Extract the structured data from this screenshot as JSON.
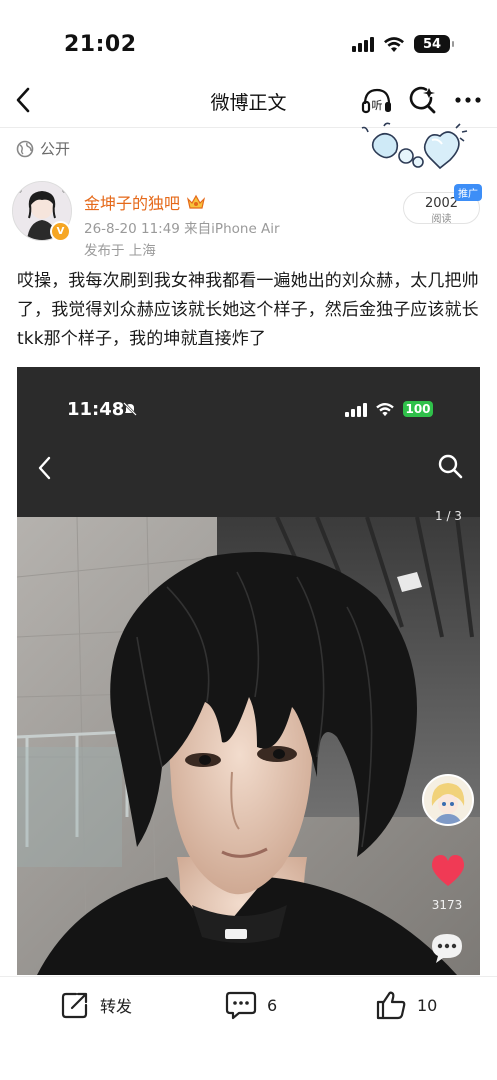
{
  "status_bar": {
    "time": "21:02",
    "battery": "54"
  },
  "nav": {
    "title": "微博正文"
  },
  "visibility": {
    "label": "公开"
  },
  "author": {
    "name": "金坤子的独吧",
    "meta": "26-8-20 11:49  来自iPhone Air",
    "location": "发布于 上海"
  },
  "reads": {
    "count": "2002",
    "label": "阅读",
    "promo_badge": "推广"
  },
  "post": {
    "text": "哎操，我每次刷到我女神我都看一遍她出的刘众赫，太几把帅了，我觉得刘众赫应该就长她这个样子，然后金独子应该就长tkk那个样子，我的坤就直接炸了"
  },
  "embed": {
    "time": "11:48",
    "battery": "100",
    "page_counter": "1 / 3",
    "likes": "3173"
  },
  "actions": {
    "repost_label": "转发",
    "comment_count": "6",
    "like_count": "10"
  },
  "colors": {
    "author_name": "#e5691a",
    "meta_text": "#9a9a9a",
    "promo_badge": "#3d8ef7",
    "embed_battery": "#2fc04a",
    "heart": "#f03a55"
  },
  "icons": [
    "back-arrow-icon",
    "listen-icon",
    "search-icon",
    "more-icon",
    "globe-icon",
    "crown-icon",
    "verified-icon",
    "mute-icon",
    "heart-icon",
    "comment-bubble-icon",
    "repost-icon",
    "like-thumb-icon"
  ]
}
